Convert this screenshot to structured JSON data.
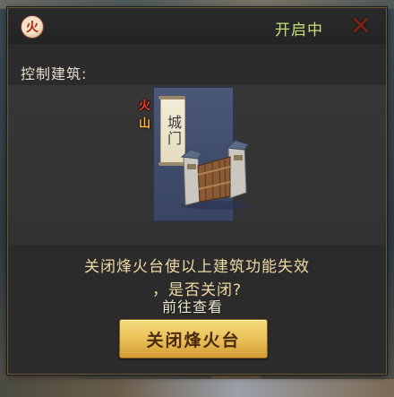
{
  "header": {
    "element_badge": "火",
    "status": "开启中",
    "close_glyph": "✕"
  },
  "section": {
    "label": "控制建筑:"
  },
  "building": {
    "tag_fire": "火",
    "tag_mountain": "山",
    "name": "城门",
    "goto_label": "前往查看"
  },
  "message": {
    "line1": "关闭烽火台使以上建筑功能失效",
    "line2": "，是否关闭?"
  },
  "action": {
    "button_label": "关闭烽火台"
  },
  "colors": {
    "status": "#c7e07a",
    "message": "#eed9a4",
    "button": "#e8bd54"
  }
}
